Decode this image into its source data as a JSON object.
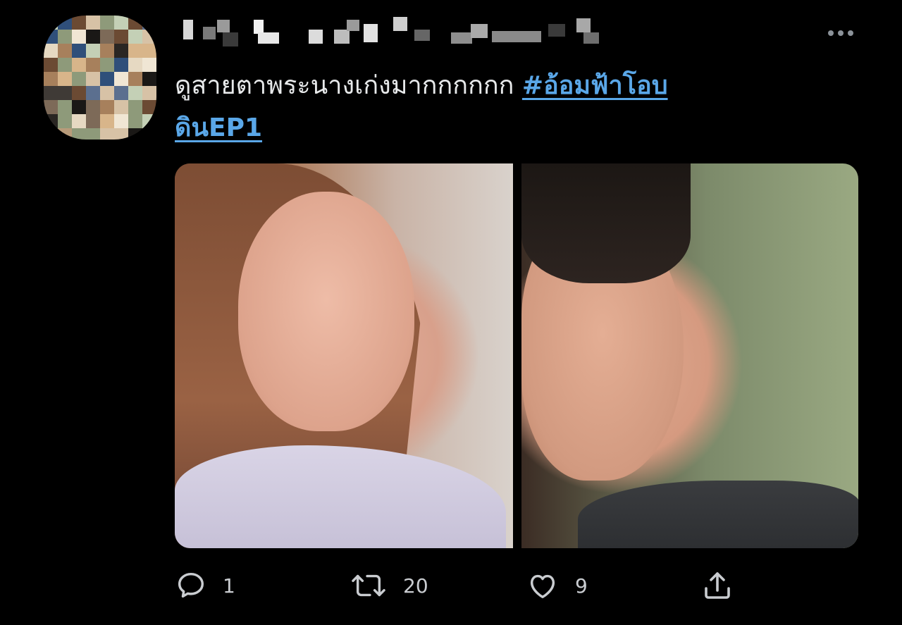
{
  "tweet": {
    "text": "ดูสายตาพระนางเก่งมากกกกกก ",
    "hashtag_line1": "#อ้อมฟ้าโอบ",
    "hashtag_line2": "ดินEP1"
  },
  "actions": {
    "reply_count": "1",
    "retweet_count": "20",
    "like_count": "9"
  },
  "icons": {
    "reply": "speech-bubble-icon",
    "retweet": "retweet-arrows-icon",
    "like": "heart-icon",
    "share": "share-upload-icon",
    "more": "more-dots-icon"
  },
  "colors": {
    "background": "#000000",
    "text": "#e7e9ea",
    "link": "#5aa7e8",
    "muted": "#c9ccd0"
  }
}
